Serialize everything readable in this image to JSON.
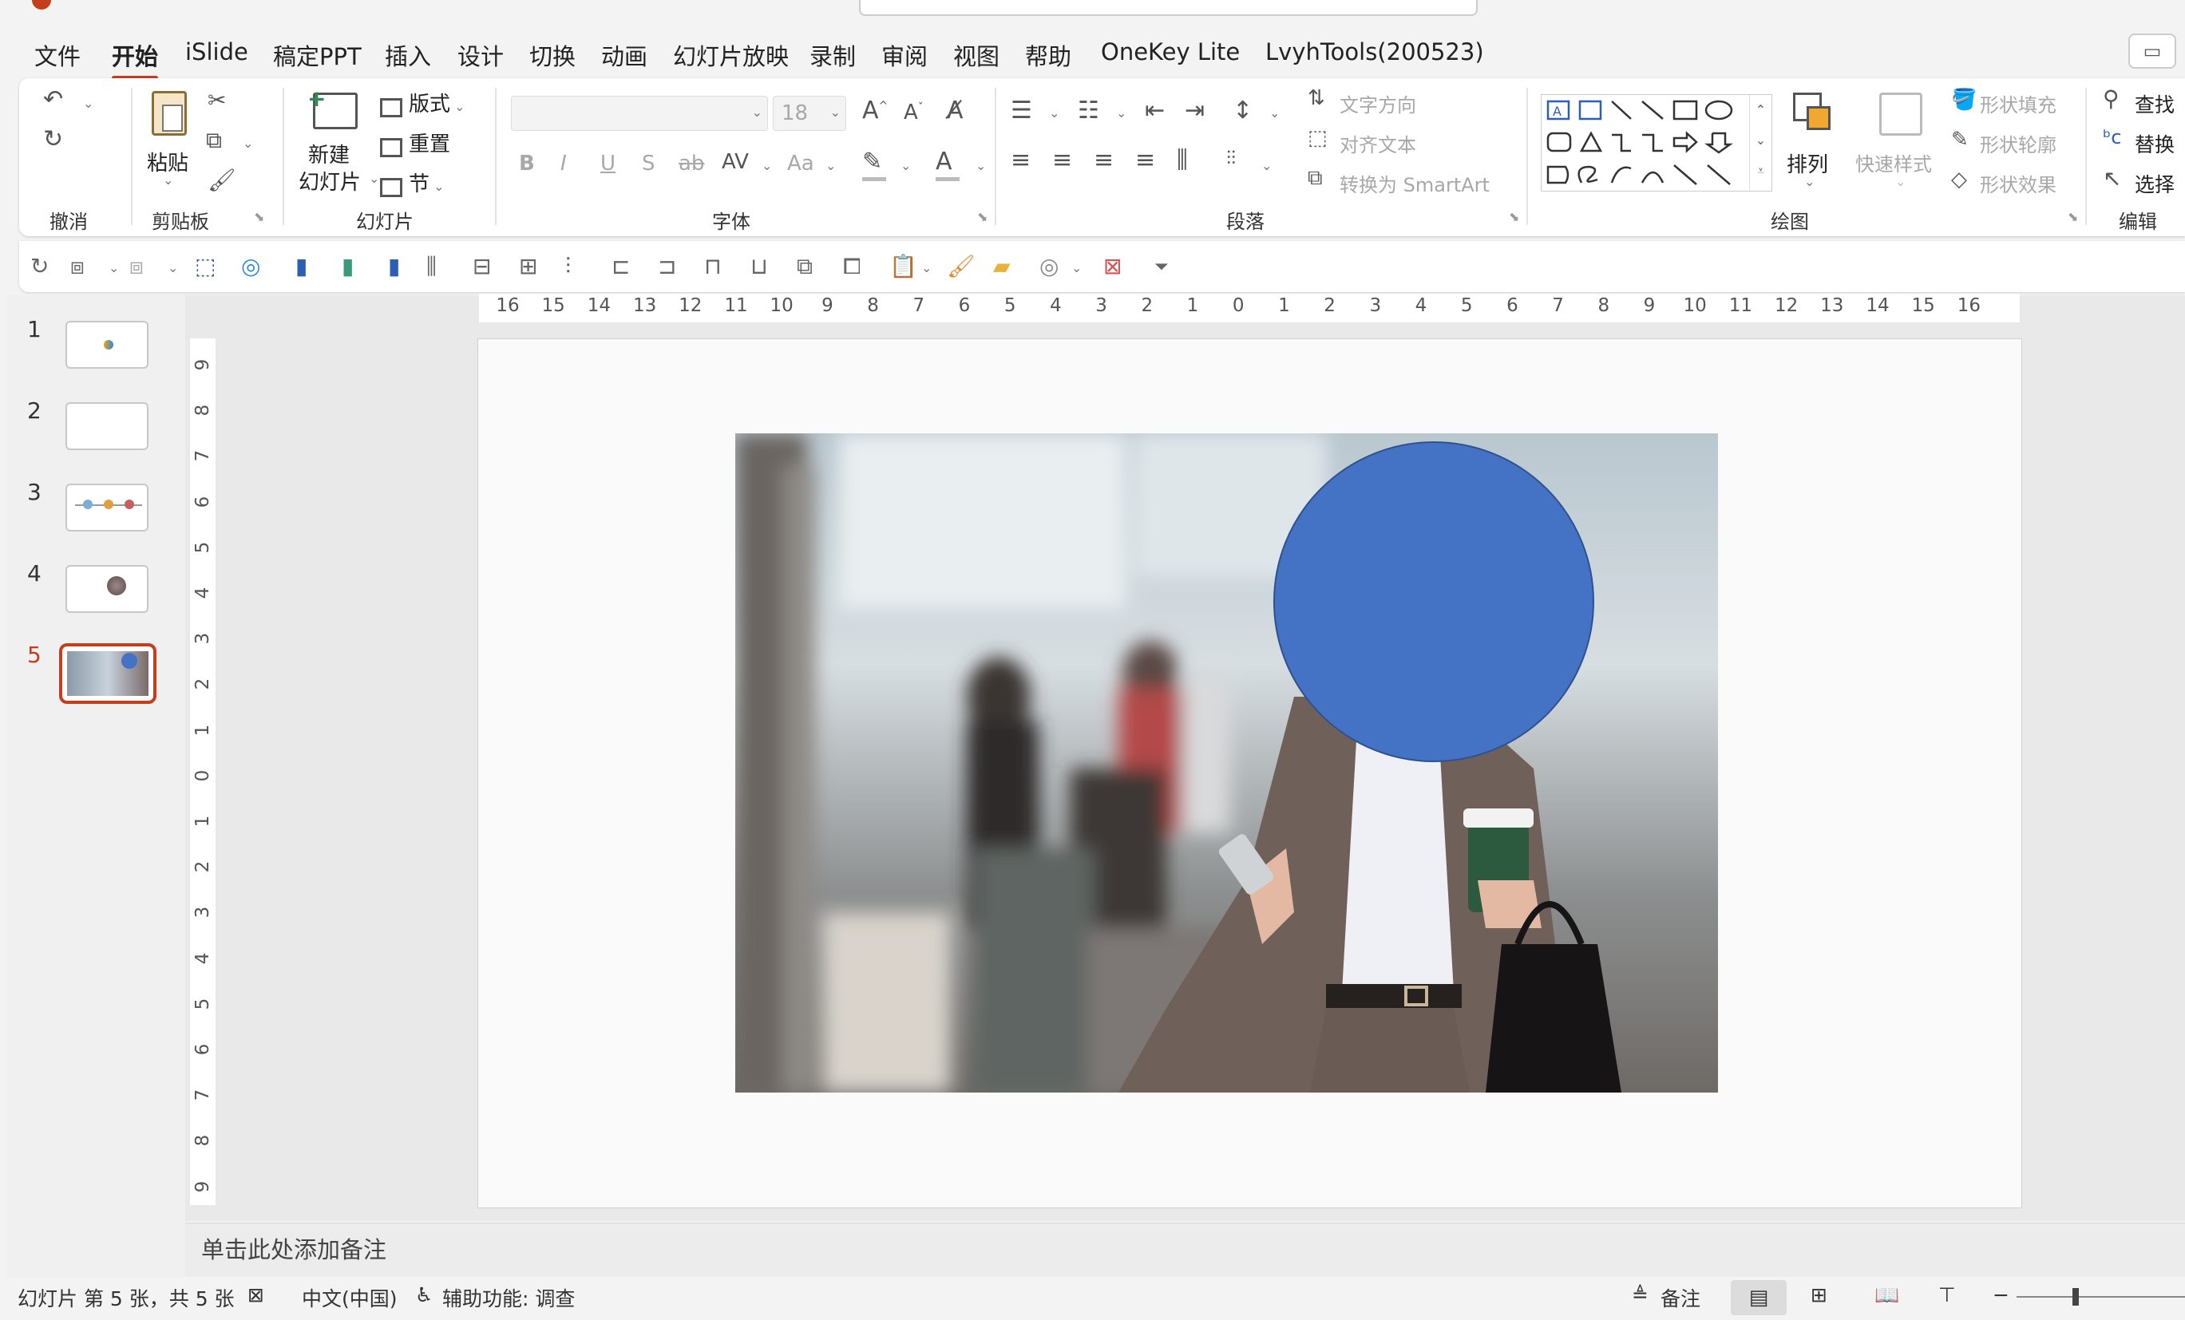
{
  "menu": {
    "items": [
      "文件",
      "开始",
      "iSlide",
      "稿定PPT",
      "插入",
      "设计",
      "切换",
      "动画",
      "幻灯片放映",
      "录制",
      "审阅",
      "视图",
      "帮助",
      "OneKey Lite",
      "LvyhTools(200523)"
    ],
    "active": "开始"
  },
  "ribbon": {
    "undo": {
      "group": "撤消"
    },
    "clipboard": {
      "paste": "粘贴",
      "group": "剪贴板"
    },
    "slides": {
      "new_slide_line1": "新建",
      "new_slide_line2": "幻灯片",
      "layout": "版式",
      "reset": "重置",
      "section": "节",
      "group": "幻灯片"
    },
    "font": {
      "size": "18",
      "bold": "B",
      "italic": "I",
      "underline": "U",
      "shadow": "S",
      "strike": "ab",
      "case": "Aa",
      "group": "字体"
    },
    "paragraph": {
      "text_direction": "文字方向",
      "align_text": "对齐文本",
      "smartart": "转换为 SmartArt",
      "group": "段落"
    },
    "drawing": {
      "arrange": "排列",
      "quick_styles": "快速样式",
      "shape_fill": "形状填充",
      "shape_outline": "形状轮廓",
      "shape_effects": "形状效果",
      "group": "绘图"
    },
    "editing": {
      "find": "查找",
      "replace": "替换",
      "select": "选择",
      "group": "编辑"
    }
  },
  "thumbnails": [
    {
      "num": "1"
    },
    {
      "num": "2"
    },
    {
      "num": "3"
    },
    {
      "num": "4"
    },
    {
      "num": "5",
      "selected": true
    }
  ],
  "ruler": {
    "h": [
      "16",
      "15",
      "14",
      "13",
      "12",
      "11",
      "10",
      "9",
      "8",
      "7",
      "6",
      "5",
      "4",
      "3",
      "2",
      "1",
      "0",
      "1",
      "2",
      "3",
      "4",
      "5",
      "6",
      "7",
      "8",
      "9",
      "10",
      "11",
      "12",
      "13",
      "14",
      "15",
      "16"
    ],
    "v": [
      "9",
      "8",
      "7",
      "6",
      "5",
      "4",
      "3",
      "2",
      "1",
      "0",
      "1",
      "2",
      "3",
      "4",
      "5",
      "6",
      "7",
      "8",
      "9"
    ]
  },
  "slide": {
    "circle_color": "#4472c4"
  },
  "notes": {
    "placeholder": "单击此处添加备注"
  },
  "status": {
    "slide_info": "幻灯片 第 5 张，共 5 张",
    "language": "中文(中国)",
    "accessibility": "辅助功能: 调查",
    "notes_btn": "备注"
  },
  "colors": {
    "accent": "#c43e1c"
  }
}
